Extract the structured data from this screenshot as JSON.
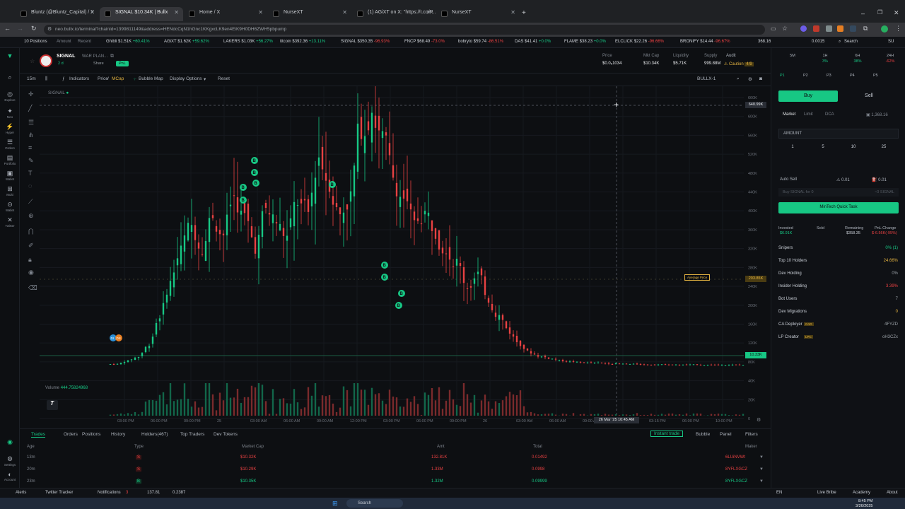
{
  "browser": {
    "tabs": [
      {
        "label": "Bluntz (@Bluntz_Capital) / X",
        "active": false
      },
      {
        "label": "SIGNAL $10.34K | Bullx",
        "active": true
      },
      {
        "label": "Home / X",
        "active": false
      },
      {
        "label": "NurseXT",
        "active": false
      },
      {
        "label": "(1) AGiXT on X: \"https://t.co/R...",
        "active": false
      },
      {
        "label": "NurseXT",
        "active": false
      }
    ],
    "url": "neo.bullx.io/terminal?chainId=1399811149&address=HENdcCqN1hGnc1KKgxcLK9en4EiK9H0DH6ZWH5pbpump"
  },
  "ticker": {
    "positions_label": "10 Positions",
    "amount_label": "Amount",
    "recent_label": "Recent",
    "items": [
      {
        "name": "Ghibli",
        "price": "$1.51K",
        "change": "+60.41%",
        "up": true
      },
      {
        "name": "AGiXT",
        "price": "$1.62K",
        "change": "+59.62%",
        "up": true
      },
      {
        "name": "LAKERS",
        "price": "$1.03K",
        "change": "+56.27%",
        "up": true
      },
      {
        "name": "titcoin",
        "price": "$392.36",
        "change": "+13.11%",
        "up": true
      },
      {
        "name": "SIGNAL",
        "price": "$350.35",
        "change": "-96.93%",
        "up": false
      },
      {
        "name": "FNCP",
        "price": "$68.49",
        "change": "-73.0%",
        "up": false
      },
      {
        "name": "bobryto",
        "price": "$59.74",
        "change": "-86.51%",
        "up": false
      },
      {
        "name": "DAS",
        "price": "$41.41",
        "change": "+0.0%",
        "up": true
      },
      {
        "name": "FLAME",
        "price": "$38.23",
        "change": "+0.0%",
        "up": true
      },
      {
        "name": "ELCLICK",
        "price": "$22.26",
        "change": "-96.66%",
        "up": false
      },
      {
        "name": "BRONIFY",
        "price": "$14.44",
        "change": "-96.67%",
        "up": false
      }
    ],
    "balance1": "368.16",
    "balance2": "0.0015",
    "search_label": "Search",
    "user_label": "SU"
  },
  "token": {
    "symbol": "SIGNAL",
    "name": "WAR PLAN...",
    "age": "2 d",
    "share_label": "Share",
    "pnl_label": "PnL",
    "stats": [
      {
        "label": "Price",
        "value": "$0.0₅1034"
      },
      {
        "label": "Mkt Cap",
        "value": "$10.34K"
      },
      {
        "label": "Liquidity",
        "value": "$5.71K"
      },
      {
        "label": "Supply",
        "value": "999.88M"
      }
    ],
    "audit_label": "Audit",
    "audit_value": "Caution",
    "audit_count": "4/9"
  },
  "chart_toolbar": {
    "interval": "15m",
    "indicators": "Indicators",
    "price": "Price",
    "mcap": "MCap",
    "bubble_map": "Bubble Map",
    "display_options": "Display Options",
    "reset": "Reset",
    "source": "BULLX-1"
  },
  "chart_data": {
    "type": "candlestick",
    "title": "SIGNAL",
    "x_ticks": [
      "03:00 PM",
      "06:00 PM",
      "09:00 PM",
      "25",
      "03:00 AM",
      "06:00 AM",
      "09:00 AM",
      "12:00 PM",
      "03:00 PM",
      "06:00 PM",
      "09:00 PM",
      "26",
      "03:00 AM",
      "06:00 AM",
      "09:00 AM",
      "12:00 PM",
      "03:15 PM",
      "06:00 PM",
      "10:00 PM"
    ],
    "y_ticks": [
      "660K",
      "600K",
      "560K",
      "520K",
      "480K",
      "440K",
      "400K",
      "360K",
      "320K",
      "280K",
      "240K",
      "200K",
      "160K",
      "120K",
      "80K",
      "40K",
      "20K",
      "0"
    ],
    "crosshair_value": "640.99K",
    "crosshair_time": "26 Mar '25  10:45 AM",
    "avg_price_label": "Average Price",
    "avg_price_value": "203.85K",
    "last_value": "10.33K",
    "ylim": [
      0,
      680000
    ],
    "volume_label": "Volume",
    "volume_value": "444.75824968",
    "price_path": [
      12,
      20,
      30,
      60,
      130,
      210,
      290,
      350,
      300,
      380,
      330,
      420,
      370,
      300,
      390,
      360,
      320,
      410,
      380,
      520,
      460,
      380,
      420,
      600,
      640,
      560,
      470,
      420,
      350,
      380,
      340,
      300,
      260,
      200,
      230,
      170,
      130,
      90,
      60,
      40,
      30,
      25,
      20,
      18,
      16,
      15,
      14,
      13,
      12,
      12,
      11,
      11,
      11,
      10.5,
      10.5,
      10.4,
      10.4,
      10.3,
      10.3,
      10.33
    ],
    "buy_markers": [
      "B",
      "B",
      "B",
      "B",
      "B",
      "B",
      "B",
      "B",
      "B",
      "B",
      "B",
      "B"
    ],
    "dev_markers": [
      "DI",
      "DS"
    ]
  },
  "bottom_tabs": {
    "tabs": [
      "Trades",
      "Orders",
      "Positions",
      "History",
      "Holders(467)",
      "Top Traders",
      "Dev Tokens"
    ],
    "instant_trade": "Instant trade",
    "bubble": "Bubble",
    "panel": "Panel",
    "filters": "Filters"
  },
  "trades": {
    "headers": [
      "Age",
      "Type",
      "Market Cap",
      "Amt",
      "Total",
      "Maker"
    ],
    "rows": [
      {
        "age": "13m",
        "type": "S",
        "mcap": "$10.32K",
        "amt": "132.81K",
        "total": "0.01492",
        "maker": "6LUiNVWt",
        "side": "sell"
      },
      {
        "age": "20m",
        "type": "S",
        "mcap": "$10.29K",
        "amt": "1.33M",
        "total": "0.0998",
        "maker": "8YFLXGCZ",
        "side": "sell"
      },
      {
        "age": "23m",
        "type": "B",
        "mcap": "$10.35K",
        "amt": "1.32M",
        "total": "0.09999",
        "maker": "8YFLXGCZ",
        "side": "buy"
      }
    ]
  },
  "status": {
    "alerts": "Alerts",
    "twitter_tracker": "Twitter Tracker",
    "notifications": "Notifications",
    "notif_count": "3",
    "sol_price": "137.81",
    "gas": "0.2387",
    "lang": "EN",
    "live_bribe": "Live Bribe",
    "academy": "Academy",
    "about": "About"
  },
  "taskbar": {
    "search": "Search",
    "time": "8:45 PM",
    "date": "3/26/2025"
  },
  "panel": {
    "timeframes": [
      {
        "label": "5M",
        "value": "",
        "up": true
      },
      {
        "label": "1H",
        "value": "3%",
        "up": true
      },
      {
        "label": "6H",
        "value": "38%",
        "up": true
      },
      {
        "label": "24H",
        "value": "-62%",
        "up": false
      }
    ],
    "presets": [
      "P1",
      "P2",
      "P3",
      "P4",
      "P5"
    ],
    "buy": "Buy",
    "sell": "Sell",
    "order_types": [
      "Market",
      "Limit",
      "DCA"
    ],
    "wallet_balance": "1,368.16",
    "amount_label": "AMOUNT",
    "quick_amounts": [
      "1",
      "5",
      "10",
      "25"
    ],
    "auto_sell": "Auto Sell",
    "slippage": "0.01",
    "priority": "0.01",
    "buy_input_placeholder": "Buy SIGNAL for 0",
    "buy_input_suffix": "~0 SIGNAL",
    "quick_task": "MinTech Quick Task",
    "invested_label": "Invested",
    "invested_value": "$6.91K",
    "sold_label": "Sold",
    "sold_value": "",
    "remaining_label": "Remaining",
    "remaining_value": "$358.35",
    "pnl_change_label": "PnL Change",
    "pnl_change_value": "$-6.56K(-95%)",
    "stats": [
      {
        "label": "Snipers",
        "value": "0% (1)",
        "tag": "",
        "color": "green"
      },
      {
        "label": "Top 10 Holders",
        "value": "24.66%",
        "tag": "",
        "color": "yellow"
      },
      {
        "label": "Dev Holding",
        "value": "0%",
        "tag": "",
        "color": "muted"
      },
      {
        "label": "Insider Holding",
        "value": "3.39%",
        "tag": "",
        "color": "red"
      },
      {
        "label": "Bot Users",
        "value": "7",
        "tag": "",
        "color": "muted"
      },
      {
        "label": "Dev Migrations",
        "value": "0",
        "tag": "",
        "color": "yellow"
      },
      {
        "label": "CA Deployer",
        "value": "4FYZD",
        "tag": "CAD",
        "color": "muted"
      },
      {
        "label": "LP Creator",
        "value": "oH3CZx",
        "tag": "LPC",
        "color": "muted"
      }
    ]
  }
}
